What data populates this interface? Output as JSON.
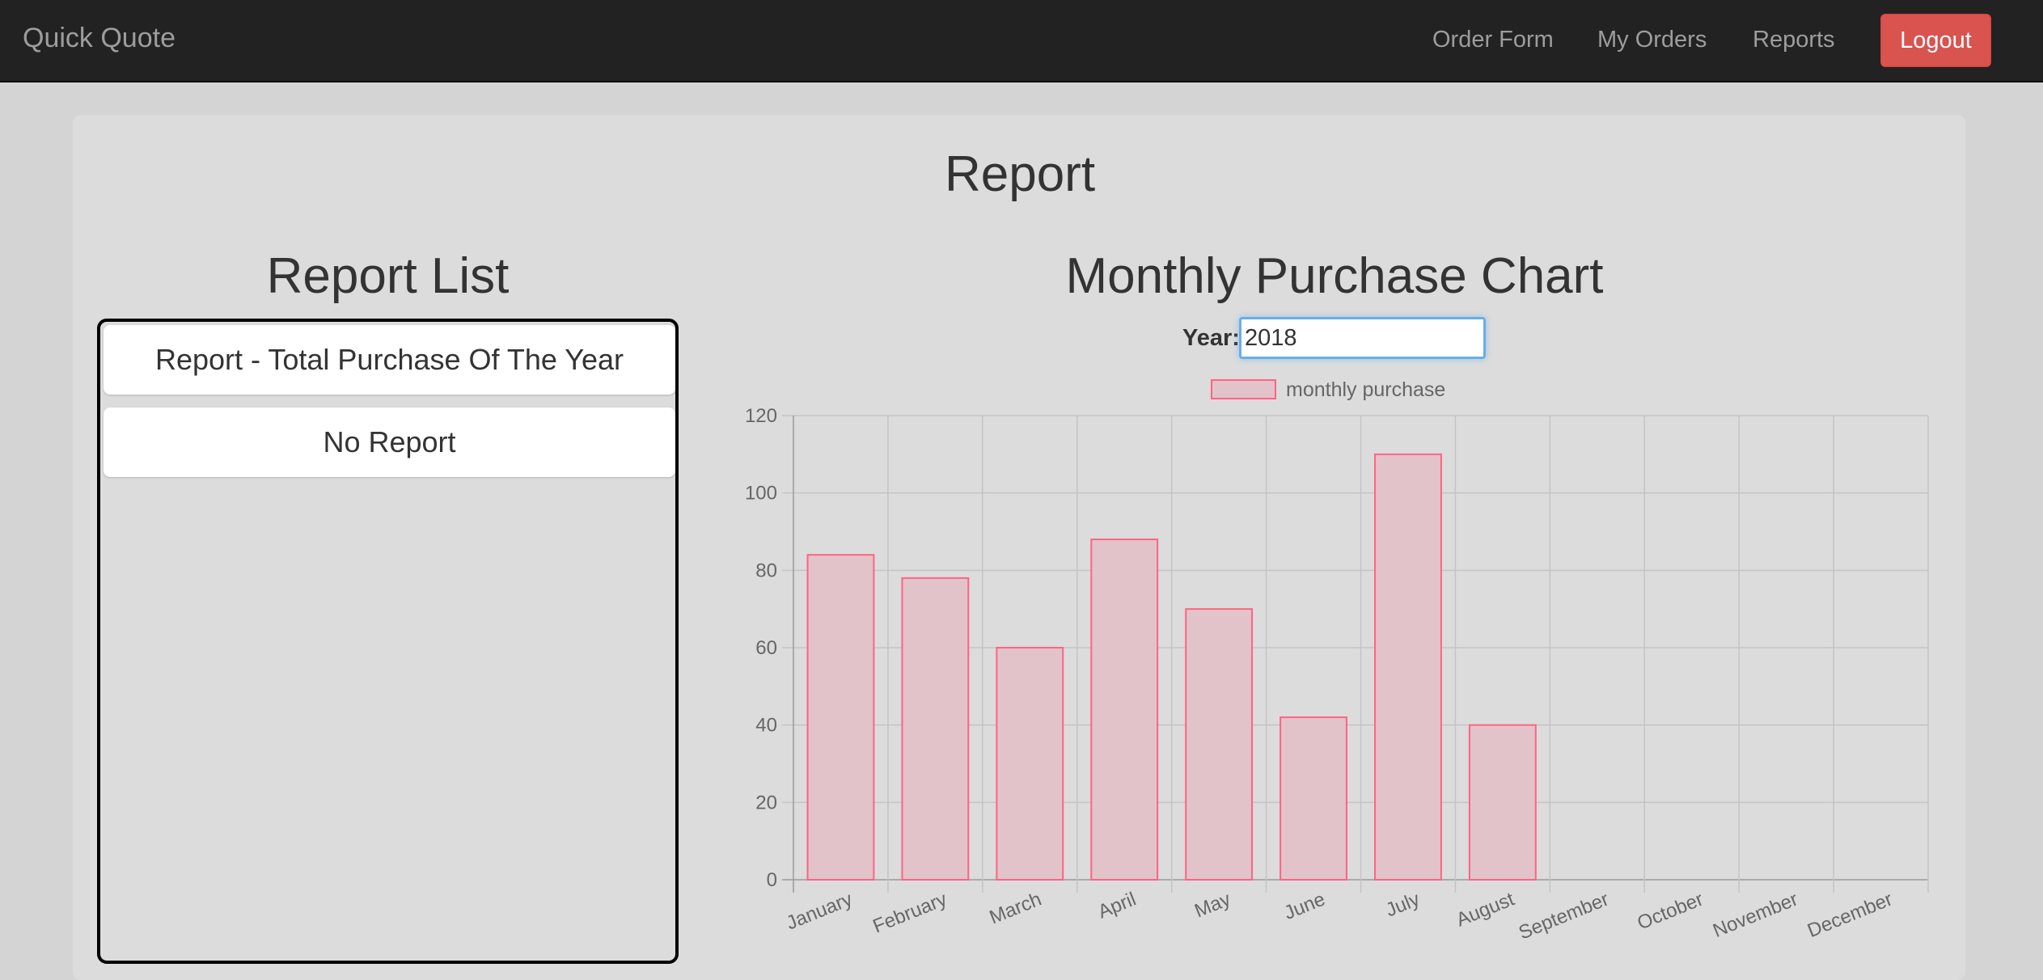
{
  "navbar": {
    "brand": "Quick Quote",
    "links": [
      {
        "label": "Order Form"
      },
      {
        "label": "My Orders"
      },
      {
        "label": "Reports"
      }
    ],
    "logout_label": "Logout"
  },
  "page": {
    "title": "Report"
  },
  "report_list": {
    "title": "Report List",
    "items": [
      {
        "label": "Report - Total Purchase Of The Year"
      },
      {
        "label": "No Report"
      }
    ]
  },
  "chart_section": {
    "title": "Monthly Purchase Chart",
    "year_label": "Year:",
    "year_value": "2018"
  },
  "chart_data": {
    "type": "bar",
    "categories": [
      "January",
      "February",
      "March",
      "April",
      "May",
      "June",
      "July",
      "August",
      "September",
      "October",
      "November",
      "December"
    ],
    "series": [
      {
        "name": "monthly purchase",
        "values": [
          84,
          78,
          60,
          88,
          70,
          42,
          110,
          40,
          null,
          null,
          null,
          null
        ]
      }
    ],
    "ylim": [
      0,
      120
    ],
    "yticks": [
      0,
      20,
      40,
      60,
      80,
      100,
      120
    ],
    "grid": true,
    "legend_position": "top",
    "colors": {
      "bar_fill": "#e3c3ca",
      "bar_stroke": "#ff6384",
      "grid": "#c4c4c4"
    }
  }
}
